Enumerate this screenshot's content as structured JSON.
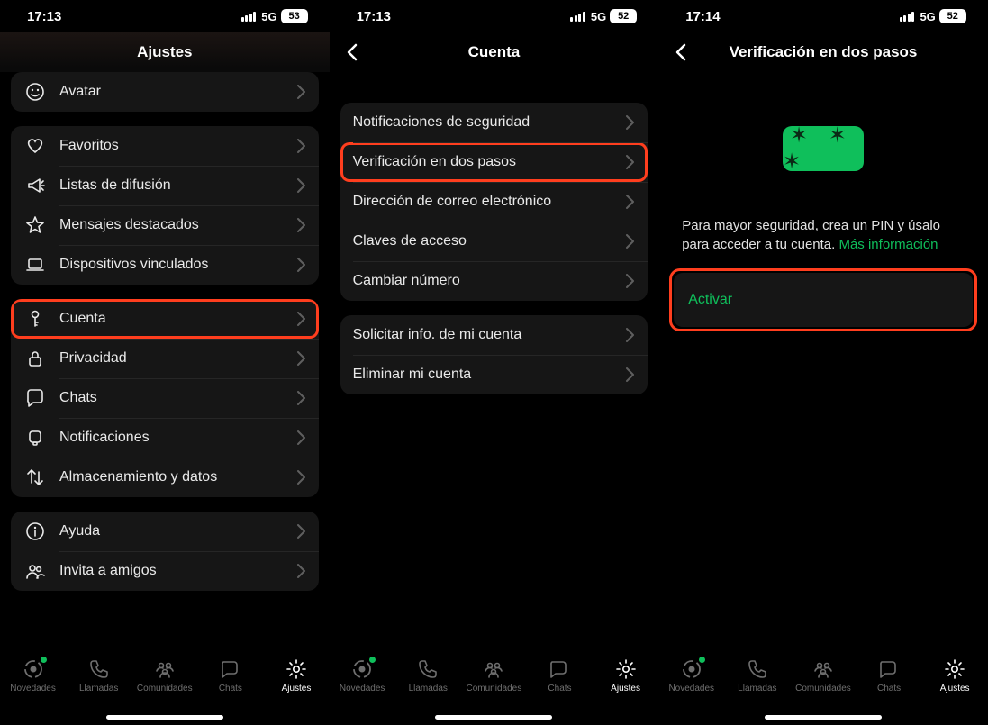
{
  "screen1": {
    "time": "17:13",
    "network": "5G",
    "battery": "53",
    "title": "Ajustes",
    "group0": {
      "avatar": "Avatar"
    },
    "group1": {
      "favoritos": "Favoritos",
      "listas": "Listas de difusión",
      "destacados": "Mensajes destacados",
      "dispositivos": "Dispositivos vinculados"
    },
    "group2": {
      "cuenta": "Cuenta",
      "privacidad": "Privacidad",
      "chats": "Chats",
      "notificaciones": "Notificaciones",
      "almacenamiento": "Almacenamiento y datos"
    },
    "group3": {
      "ayuda": "Ayuda",
      "invita": "Invita a amigos"
    }
  },
  "screen2": {
    "time": "17:13",
    "network": "5G",
    "battery": "52",
    "title": "Cuenta",
    "group1": {
      "notif_seguridad": "Notificaciones de seguridad",
      "verificacion": "Verificación en dos pasos",
      "correo": "Dirección de correo electrónico",
      "claves": "Claves de acceso",
      "cambiar_num": "Cambiar número"
    },
    "group2": {
      "solicitar": "Solicitar info. de mi cuenta",
      "eliminar": "Eliminar mi cuenta"
    }
  },
  "screen3": {
    "time": "17:14",
    "network": "5G",
    "battery": "52",
    "title": "Verificación en dos pasos",
    "pin_placeholder": "✶ ✶ ✶",
    "desc_text": "Para mayor seguridad, crea un PIN y úsalo para acceder a tu cuenta. ",
    "more_info": "Más información",
    "activate": "Activar"
  },
  "tabs": {
    "novedades": "Novedades",
    "llamadas": "Llamadas",
    "comunidades": "Comunidades",
    "chats": "Chats",
    "ajustes": "Ajustes"
  }
}
